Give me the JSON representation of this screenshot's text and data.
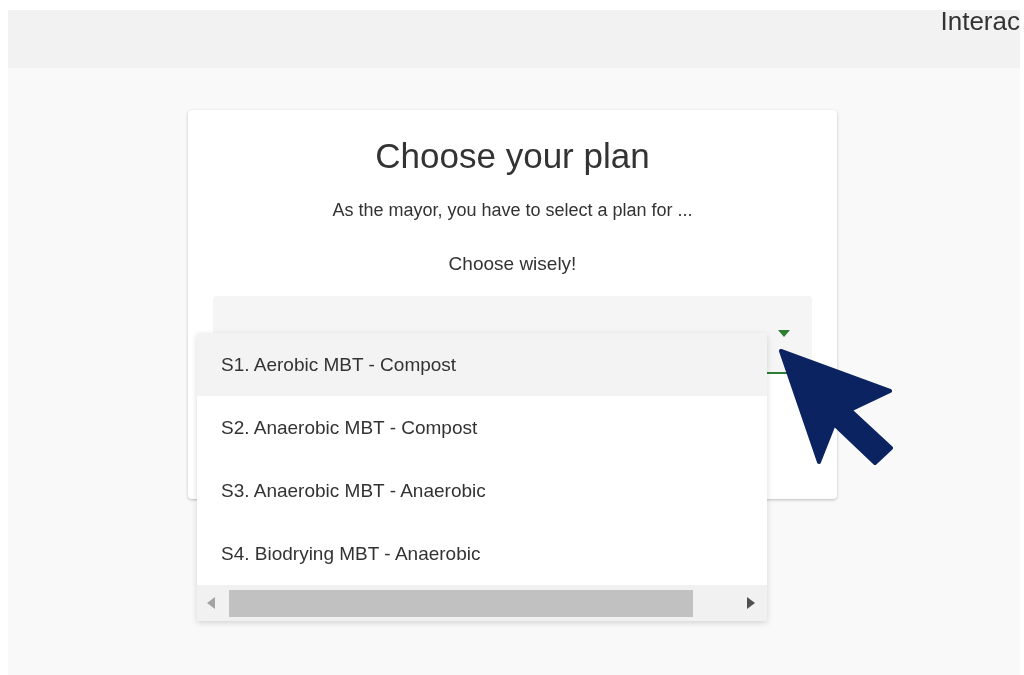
{
  "header": {
    "title": "Interac"
  },
  "card": {
    "title": "Choose your plan",
    "description": "As the mayor, you have to select a plan for ...",
    "prompt": "Choose wisely!"
  },
  "dropdown": {
    "expanded": true,
    "options": [
      {
        "label": "S1. Aerobic MBT - Compost",
        "selected": true
      },
      {
        "label": "S2. Anaerobic MBT - Compost",
        "selected": false
      },
      {
        "label": "S3. Anaerobic MBT - Anaerobic",
        "selected": false
      },
      {
        "label": "S4. Biodrying MBT - Anaerobic",
        "selected": false
      }
    ]
  }
}
